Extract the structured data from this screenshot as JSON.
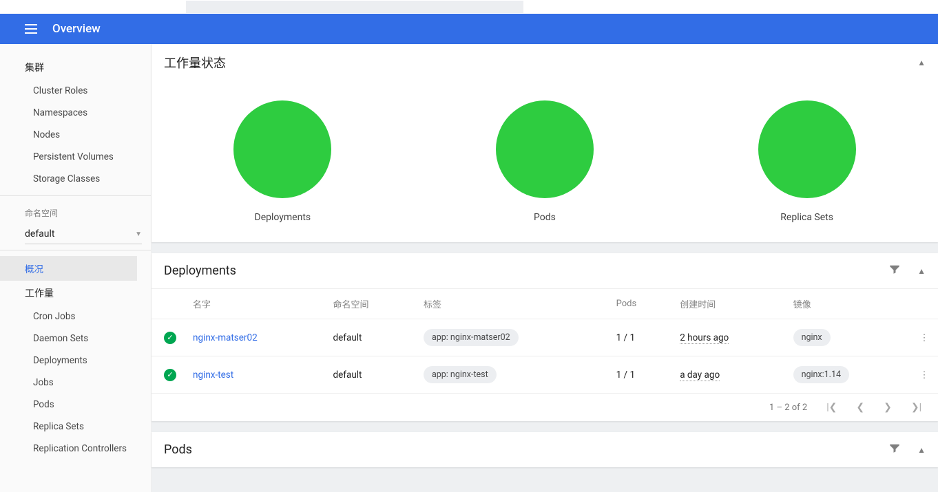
{
  "header": {
    "title": "Overview"
  },
  "sidebar": {
    "cluster_heading": "集群",
    "cluster_items": [
      "Cluster Roles",
      "Namespaces",
      "Nodes",
      "Persistent Volumes",
      "Storage Classes"
    ],
    "namespace_label": "命名空间",
    "namespace_selected": "default",
    "overview_item": "概况",
    "workloads_heading": "工作量",
    "workload_items": [
      "Cron Jobs",
      "Daemon Sets",
      "Deployments",
      "Jobs",
      "Pods",
      "Replica Sets",
      "Replication Controllers"
    ]
  },
  "workload_status": {
    "title": "工作量状态",
    "items": [
      "Deployments",
      "Pods",
      "Replica Sets"
    ]
  },
  "deployments": {
    "title": "Deployments",
    "columns": {
      "name": "名字",
      "namespace": "命名空间",
      "labels": "标签",
      "pods": "Pods",
      "created": "创建时间",
      "images": "镜像"
    },
    "rows": [
      {
        "name": "nginx-matser02",
        "namespace": "default",
        "label": "app: nginx-matser02",
        "pods": "1 / 1",
        "created": "2 hours ago",
        "image": "nginx"
      },
      {
        "name": "nginx-test",
        "namespace": "default",
        "label": "app: nginx-test",
        "pods": "1 / 1",
        "created": "a day ago",
        "image": "nginx:1.14"
      }
    ],
    "pagination": "1 – 2 of 2"
  },
  "pods": {
    "title": "Pods"
  }
}
